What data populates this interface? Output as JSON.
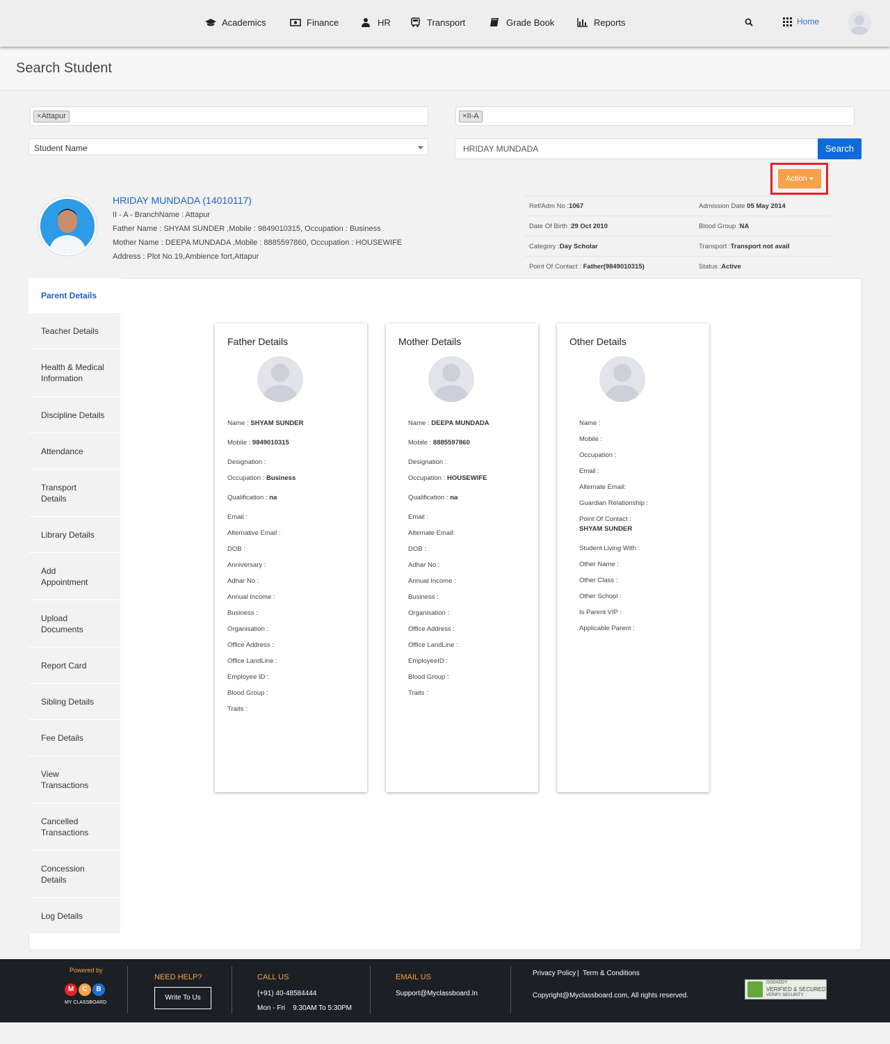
{
  "nav": {
    "items": [
      {
        "label": "Academics",
        "icon": "graduation-cap-icon"
      },
      {
        "label": "Finance",
        "icon": "money-icon"
      },
      {
        "label": "HR",
        "icon": "user-icon"
      },
      {
        "label": "Transport",
        "icon": "bus-icon"
      },
      {
        "label": "Grade Book",
        "icon": "book-icon"
      },
      {
        "label": "Reports",
        "icon": "bar-chart-icon"
      }
    ],
    "home_label": "Home"
  },
  "page": {
    "title": "Search Student"
  },
  "filters": {
    "branch_tag": "Attapur",
    "class_tag": "II-A",
    "search_by": "Student Name",
    "search_value": "HRIDAY MUNDADA",
    "search_button": "Search",
    "action_button": "Action",
    "tag_remove": "×"
  },
  "student": {
    "name_line": "HRIDAY MUNDADA (14010117)",
    "class_line": "II - A - BranchName : Attapur",
    "father_line": "Father Name : SHYAM SUNDER ,Mobile : 9849010315, Occupation : Business",
    "mother_line": "Mother Name : DEEPA MUNDADA ,Mobile : 8885597860, Occupation : HOUSEWIFE",
    "address_line": "Address : Plot No.19,Ambience fort,Attapur",
    "info": [
      {
        "l_label": "Ref/Adm No :",
        "l_value": "1067",
        "r_label": "Admission Date ",
        "r_value": "05 May 2014"
      },
      {
        "l_label": "Date Of Birth :",
        "l_value": "29 Oct 2010",
        "r_label": "Blood Group :",
        "r_value": "NA"
      },
      {
        "l_label": "Category :",
        "l_value": "Day Scholar",
        "r_label": "Transport :",
        "r_value": "Transport not avail"
      },
      {
        "l_label": "Point Of Contact : ",
        "l_value": "Father(9849010315)",
        "r_label": "Status :",
        "r_value": "Active"
      }
    ]
  },
  "sidebar": {
    "items": [
      "Parent Details",
      "Teacher Details",
      "Health & Medical Information",
      "Discipline Details",
      "Attendance",
      "Transport Details",
      "Library Details",
      "Add Appointment",
      "Upload Documents",
      "Report Card",
      "Sibling Details",
      "Fee Details",
      "View Transactions",
      "Cancelled Transactions",
      "Concession Details",
      "Log Details"
    ]
  },
  "father": {
    "title": "Father Details",
    "fields": [
      {
        "label": "Name : ",
        "value": "SHYAM SUNDER"
      },
      {
        "label": "Mobile : ",
        "value": "9849010315"
      },
      {
        "label": "Designation : ",
        "value": ""
      },
      {
        "label": "Occupation : ",
        "value": "Business"
      },
      {
        "label": "Qualification : ",
        "value": "na"
      },
      {
        "label": "Email : ",
        "value": ""
      },
      {
        "label": "Alternative Email : ",
        "value": ""
      },
      {
        "label": "DOB : ",
        "value": ""
      },
      {
        "label": "Anniversary : ",
        "value": ""
      },
      {
        "label": "Adhar No : ",
        "value": ""
      },
      {
        "label": "Annual Income : ",
        "value": ""
      },
      {
        "label": "Business : ",
        "value": ""
      },
      {
        "label": "Organisation : ",
        "value": ""
      },
      {
        "label": "Office Address : ",
        "value": ""
      },
      {
        "label": "Office LandLine : ",
        "value": ""
      },
      {
        "label": "Employee ID : ",
        "value": ""
      },
      {
        "label": "Blood Group : ",
        "value": ""
      },
      {
        "label": "Traits : ",
        "value": ""
      }
    ]
  },
  "mother": {
    "title": "Mother Details",
    "fields": [
      {
        "label": "Name : ",
        "value": "DEEPA MUNDADA"
      },
      {
        "label": "Mobile : ",
        "value": "8885597860"
      },
      {
        "label": "Designation : ",
        "value": ""
      },
      {
        "label": "Occupation : ",
        "value": "HOUSEWIFE"
      },
      {
        "label": "Qualification : ",
        "value": "na"
      },
      {
        "label": "Email : ",
        "value": ""
      },
      {
        "label": "Alternate Email: ",
        "value": ""
      },
      {
        "label": "DOB : ",
        "value": ""
      },
      {
        "label": "Adhar No : ",
        "value": ""
      },
      {
        "label": "Annual Income : ",
        "value": ""
      },
      {
        "label": "Business : ",
        "value": ""
      },
      {
        "label": "Organisation : ",
        "value": ""
      },
      {
        "label": "Office Address : ",
        "value": ""
      },
      {
        "label": "Office LandLine : ",
        "value": ""
      },
      {
        "label": "EmployeeID : ",
        "value": ""
      },
      {
        "label": "Blood Group : ",
        "value": ""
      },
      {
        "label": "Traits : ",
        "value": ""
      }
    ]
  },
  "other": {
    "title": "Other Details",
    "fields": [
      {
        "label": "Name : ",
        "value": ""
      },
      {
        "label": "Mobile : ",
        "value": ""
      },
      {
        "label": "Occupation : ",
        "value": ""
      },
      {
        "label": "Email : ",
        "value": ""
      },
      {
        "label": "Alternate Email: ",
        "value": ""
      },
      {
        "label": "Guardian Relationship : ",
        "value": ""
      },
      {
        "label": "Point Of Contact : ",
        "value": "SHYAM SUNDER"
      },
      {
        "label": "Student Living With : ",
        "value": ""
      },
      {
        "label": "Other Name : ",
        "value": ""
      },
      {
        "label": "Other Class : ",
        "value": ""
      },
      {
        "label": "Other School : ",
        "value": ""
      },
      {
        "label": "Is Parent VIP : ",
        "value": ""
      },
      {
        "label": "Applicable Parent : ",
        "value": ""
      }
    ]
  },
  "footer": {
    "powered_by": "Powered by",
    "brand": "MY CLASSBOARD",
    "logo_letters": [
      "M",
      "C",
      "B"
    ],
    "need_help": "NEED HELP?",
    "write_to_us": "Write To Us",
    "call_us": "CALL US",
    "phone": "(+91) 40-48584444",
    "hours": "Mon - Fri    9:30AM To 5:30PM",
    "email_us": "EMAIL US",
    "email": "Support@Myclassboard.In",
    "privacy": "Privacy Policy",
    "pipe": "|",
    "terms": "Term & Conditions",
    "copyright": "Copyright@Myclassboard.com, All rights reserved.",
    "badge_line1": "GODADDY",
    "badge_line2": "VERIFIED & SECURED",
    "badge_line3": "VERIFY SECURITY"
  },
  "colors": {
    "accent_blue": "#1f5fc9",
    "search_blue": "#0f6bd8",
    "action_orange": "#f6a24a",
    "highlight_red": "#e8202a",
    "footer_bg": "#1c2024"
  }
}
